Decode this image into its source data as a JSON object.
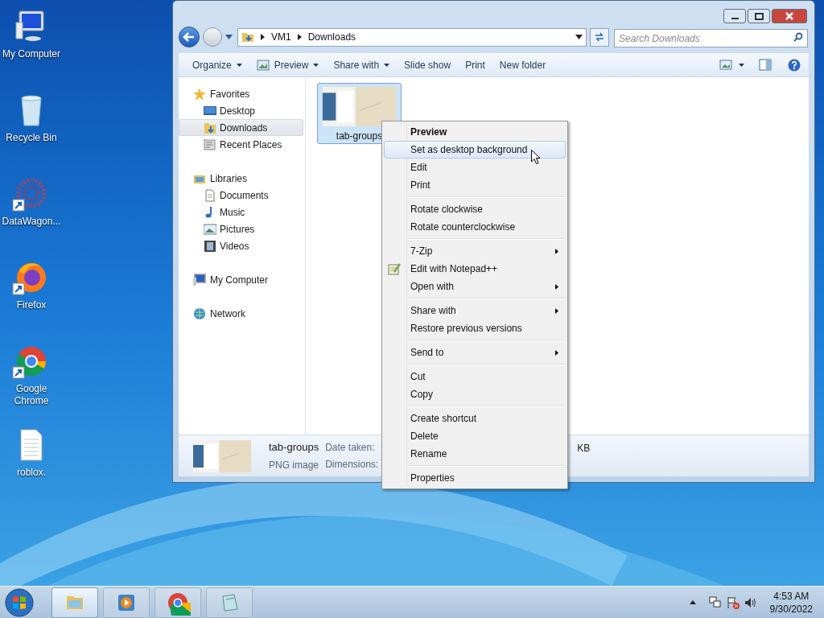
{
  "desktop_icons": [
    {
      "label": "My Computer",
      "kind": "computer",
      "shortcut": false
    },
    {
      "label": "Recycle Bin",
      "kind": "recycle-bin",
      "shortcut": false
    },
    {
      "label": "DataWagon...",
      "kind": "app",
      "shortcut": true
    },
    {
      "label": "Firefox",
      "kind": "firefox",
      "shortcut": true
    },
    {
      "label": "Google Chrome",
      "kind": "chrome",
      "shortcut": true
    },
    {
      "label": "roblox.",
      "kind": "text-file",
      "shortcut": false
    }
  ],
  "window": {
    "address": {
      "path": [
        "VM1",
        "Downloads"
      ]
    },
    "search": {
      "placeholder": "Search Downloads"
    },
    "toolbar": [
      {
        "label": "Organize",
        "dropdown": true,
        "icon": false
      },
      {
        "label": "Preview",
        "dropdown": true,
        "icon": true
      },
      {
        "label": "Share with",
        "dropdown": true,
        "icon": false
      },
      {
        "label": "Slide show",
        "dropdown": false,
        "icon": false
      },
      {
        "label": "Print",
        "dropdown": false,
        "icon": false
      },
      {
        "label": "New folder",
        "dropdown": false,
        "icon": false
      }
    ],
    "nav_pane": [
      {
        "label": "Favorites",
        "kind": "star",
        "children": [
          {
            "label": "Desktop",
            "kind": "desktop",
            "selected": false
          },
          {
            "label": "Downloads",
            "kind": "downloads",
            "selected": true
          },
          {
            "label": "Recent Places",
            "kind": "recent",
            "selected": false
          }
        ]
      },
      {
        "label": "Libraries",
        "kind": "library",
        "children": [
          {
            "label": "Documents",
            "kind": "document",
            "selected": false
          },
          {
            "label": "Music",
            "kind": "music",
            "selected": false
          },
          {
            "label": "Pictures",
            "kind": "pictures",
            "selected": false
          },
          {
            "label": "Videos",
            "kind": "videos",
            "selected": false
          }
        ]
      },
      {
        "label": "My Computer",
        "kind": "computer"
      },
      {
        "label": "Network",
        "kind": "network"
      }
    ],
    "files": [
      {
        "name": "tab-groups",
        "selected": true
      }
    ],
    "details": {
      "name": "tab-groups",
      "type": "PNG image",
      "fields": [
        "Date taken:",
        "Dimensions:"
      ],
      "size_unit": "KB"
    }
  },
  "context_menu": [
    [
      {
        "label": "Preview",
        "bold": true,
        "selected": false,
        "submenu": false,
        "icon": false
      },
      {
        "label": "Set as desktop background",
        "bold": false,
        "selected": true,
        "submenu": false,
        "icon": false
      },
      {
        "label": "Edit",
        "bold": false,
        "selected": false,
        "submenu": false,
        "icon": false
      },
      {
        "label": "Print",
        "bold": false,
        "selected": false,
        "submenu": false,
        "icon": false
      }
    ],
    [
      {
        "label": "Rotate clockwise",
        "bold": false,
        "selected": false,
        "submenu": false,
        "icon": false
      },
      {
        "label": "Rotate counterclockwise",
        "bold": false,
        "selected": false,
        "submenu": false,
        "icon": false
      }
    ],
    [
      {
        "label": "7-Zip",
        "bold": false,
        "selected": false,
        "submenu": true,
        "icon": false
      },
      {
        "label": "Edit with Notepad++",
        "bold": false,
        "selected": false,
        "submenu": false,
        "icon": true
      },
      {
        "label": "Open with",
        "bold": false,
        "selected": false,
        "submenu": true,
        "icon": false
      }
    ],
    [
      {
        "label": "Share with",
        "bold": false,
        "selected": false,
        "submenu": true,
        "icon": false
      },
      {
        "label": "Restore previous versions",
        "bold": false,
        "selected": false,
        "submenu": false,
        "icon": false
      }
    ],
    [
      {
        "label": "Send to",
        "bold": false,
        "selected": false,
        "submenu": true,
        "icon": false
      }
    ],
    [
      {
        "label": "Cut",
        "bold": false,
        "selected": false,
        "submenu": false,
        "icon": false
      },
      {
        "label": "Copy",
        "bold": false,
        "selected": false,
        "submenu": false,
        "icon": false
      }
    ],
    [
      {
        "label": "Create shortcut",
        "bold": false,
        "selected": false,
        "submenu": false,
        "icon": false
      },
      {
        "label": "Delete",
        "bold": false,
        "selected": false,
        "submenu": false,
        "icon": false
      },
      {
        "label": "Rename",
        "bold": false,
        "selected": false,
        "submenu": false,
        "icon": false
      }
    ],
    [
      {
        "label": "Properties",
        "bold": false,
        "selected": false,
        "submenu": false,
        "icon": false
      }
    ]
  ],
  "taskbar": {
    "items": [
      {
        "kind": "explorer",
        "selected": true
      },
      {
        "kind": "media-player",
        "selected": false
      },
      {
        "kind": "chrome",
        "selected": false
      },
      {
        "kind": "notepad",
        "selected": false
      }
    ],
    "clock": {
      "time": "4:53 AM",
      "date": "9/30/2022"
    }
  }
}
